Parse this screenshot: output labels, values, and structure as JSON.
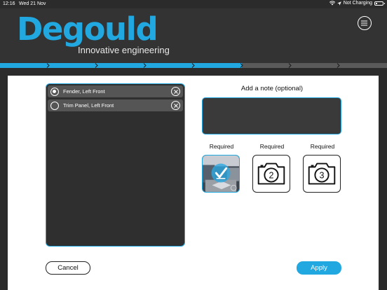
{
  "status_bar": {
    "time": "12:16",
    "date": "Wed 21 Nov",
    "charging": "Not Charging",
    "icons": [
      "wifi-icon",
      "location-arrow-icon",
      "battery-icon"
    ],
    "battery_level": 0.15
  },
  "header": {
    "logo_text": "Degould",
    "tagline": "Innovative engineering",
    "menu_icon": "hamburger-menu-icon"
  },
  "progress": {
    "total_steps": 8,
    "completed_steps": 5
  },
  "damage_list": {
    "items": [
      {
        "label": "Fender, Left Front",
        "selected": true
      },
      {
        "label": "Trim Panel, Left Front",
        "selected": false
      }
    ]
  },
  "note": {
    "title": "Add a note (optional)",
    "value": ""
  },
  "photos": [
    {
      "label": "Required",
      "state": "captured",
      "icon": "photo-checkmark-icon"
    },
    {
      "label": "Required",
      "state": "empty",
      "number": "2",
      "icon": "camera-icon"
    },
    {
      "label": "Required",
      "state": "empty",
      "number": "3",
      "icon": "camera-icon"
    }
  ],
  "actions": {
    "cancel_label": "Cancel",
    "apply_label": "Apply"
  },
  "colors": {
    "accent": "#22a8e0",
    "header_bg": "#333333",
    "list_bg": "#2f2f2f",
    "item_bg": "#555555"
  }
}
